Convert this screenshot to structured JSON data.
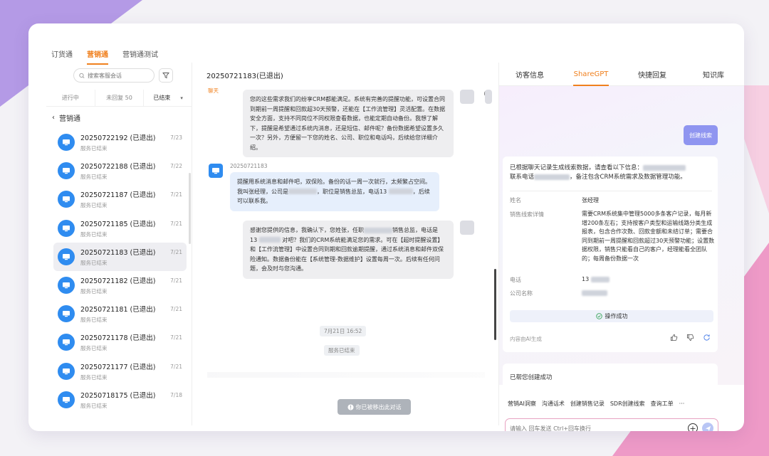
{
  "top_tabs": [
    "订货通",
    "营销通",
    "营销通测试"
  ],
  "left": {
    "search_placeholder": "搜索客服会话",
    "status_tabs": [
      "进行中",
      "未回复 50",
      "已结束"
    ],
    "back_label": "营销通",
    "conversations": [
      {
        "title": "20250722192 (已退出)",
        "sub": "服务已结束",
        "date": "7/23"
      },
      {
        "title": "20250722188 (已退出)",
        "sub": "服务已结束",
        "date": "7/22"
      },
      {
        "title": "20250721187 (已退出)",
        "sub": "服务已结束",
        "date": "7/21"
      },
      {
        "title": "20250721185 (已退出)",
        "sub": "服务已结束",
        "date": "7/21"
      },
      {
        "title": "20250721183 (已退出)",
        "sub": "服务已结束",
        "date": "7/21"
      },
      {
        "title": "20250721182 (已退出)",
        "sub": "服务已结束",
        "date": "7/21"
      },
      {
        "title": "20250721181 (已退出)",
        "sub": "服务已结束",
        "date": "7/21"
      },
      {
        "title": "20250721178 (已退出)",
        "sub": "服务已结束",
        "date": "7/21"
      },
      {
        "title": "20250721177 (已退出)",
        "sub": "服务已结束",
        "date": "7/21"
      },
      {
        "title": "20250718175 (已退出)",
        "sub": "服务已结束",
        "date": "7/18"
      }
    ]
  },
  "chat": {
    "title": "20250721183(已退出)",
    "tag": "聊天",
    "msg1": "您的这些需求我们的纷享CRM都能满足。系统有完善的提醒功能，可设置合同到期前一周提醒和回款超30天预警，还能在【工作流管理】灵活配置。在数据安全方面，支持不同岗位不同权限查看数据，也能定期自动备份。我想了解下，提醒是希望通过系统内消息，还是短信、邮件呢？备份数据希望设置多久一次？另外，方便留一下您的姓名、公司、职位和电话吗，后续给您详细介绍。",
    "sender": "20250721183",
    "msg2_a": "提醒用系统消息和邮件吧，双保险。备份的话一周一次就行，太频繁占空间。我叫张经理，公司是",
    "msg2_b": "，职位是销售总监，电话13",
    "msg2_c": "，后续可以联系我。",
    "msg3_a": "感谢您提供的信息，我确认下，您姓张，任职",
    "msg3_b": "销售总监，电话是 13",
    "msg3_c": "对吧？我们的CRM系统能满足您的需求。可在【超时提醒设置】和【工作流管理】中设置合同到期和回款逾期提醒，通过系统消息和邮件双保险通知。数据备份能在【系统管理-数据维护】设置每周一次。后续有任何问题，会及时与您沟通。",
    "time": "7月21日 16:52",
    "service_ended": "服务已结束",
    "removed_label": "你已被移出此对话"
  },
  "right": {
    "tabs": [
      "访客信息",
      "ShareGPT",
      "快捷回复",
      "知识库"
    ],
    "create_btn": "创建线索",
    "intro": "已根据聊天记录生成线索数据，请查看以下信息：",
    "intro2": "联系电话",
    "intro3": "，备注包含CRM系统需求及数据管理功能。",
    "fields": {
      "name_label": "姓名",
      "name_value": "张经理",
      "detail_label": "销售线索详情",
      "detail_value": "需要CRM系统集中管理5000多条客户记录，每月新增200条左右；支持按客户类型和运输线路分类生成报表，包含合作次数、回款金额和未结订单；需要合同到期前一周提醒和回款超过30天预警功能；设置数据权限，销售只能看自己的客户，经理能看全团队的；每周备份数据一次",
      "phone_label": "电话",
      "phone_value": "13",
      "company_label": "公司名称"
    },
    "success": "操作成功",
    "ai_note": "内容由AI生成",
    "done": "已帮您创建成功",
    "tools": [
      "营销AI洞察",
      "沟通话术",
      "创建销售记录",
      "SDR创建线索",
      "查询工单",
      "···"
    ],
    "input_placeholder": "请输入 回车发送 Ctrl+回车换行"
  },
  "colors": {
    "accent": "#f0801e",
    "avatar_blue": "#2f8cf0",
    "create_btn": "#8f95f0"
  }
}
